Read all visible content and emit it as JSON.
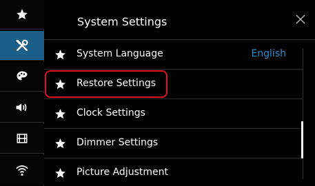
{
  "header": {
    "title": "System Settings",
    "close_icon": "close-icon"
  },
  "sidebar": {
    "items": [
      {
        "name": "favorites",
        "icon": "star-icon",
        "active": false
      },
      {
        "name": "settings",
        "icon": "tools-icon",
        "active": true
      },
      {
        "name": "theme",
        "icon": "palette-icon",
        "active": false
      },
      {
        "name": "audio",
        "icon": "speaker-icon",
        "active": false
      },
      {
        "name": "video",
        "icon": "film-icon",
        "active": false
      },
      {
        "name": "wireless",
        "icon": "wifi-icon",
        "active": false
      }
    ]
  },
  "settings_list": {
    "items": [
      {
        "label": "System Language",
        "value": "English"
      },
      {
        "label": "Restore Settings",
        "highlighted": true
      },
      {
        "label": "Clock Settings"
      },
      {
        "label": "Dimmer Settings"
      },
      {
        "label": "Picture Adjustment"
      }
    ]
  },
  "colors": {
    "active_tab": "#1d5e89",
    "value_text": "#2f8fcf",
    "highlight_border": "#e0141e"
  }
}
